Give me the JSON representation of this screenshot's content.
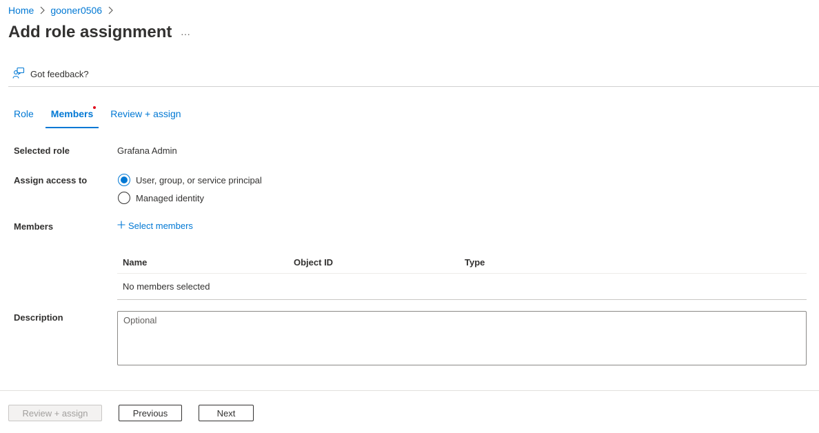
{
  "breadcrumb": {
    "items": [
      "Home",
      "gooner0506"
    ]
  },
  "page": {
    "title": "Add role assignment",
    "more_label": "···"
  },
  "feedback": {
    "label": "Got feedback?"
  },
  "tabs": [
    {
      "label": "Role",
      "active": false
    },
    {
      "label": "Members",
      "active": true
    },
    {
      "label": "Review + assign",
      "active": false
    }
  ],
  "form": {
    "selected_role": {
      "label": "Selected role",
      "value": "Grafana Admin"
    },
    "assign_access": {
      "label": "Assign access to",
      "options": [
        {
          "label": "User, group, or service principal",
          "checked": true
        },
        {
          "label": "Managed identity",
          "checked": false
        }
      ]
    },
    "members": {
      "label": "Members",
      "select_label": "Select members",
      "columns": [
        "Name",
        "Object ID",
        "Type"
      ],
      "empty_text": "No members selected"
    },
    "description": {
      "label": "Description",
      "placeholder": "Optional"
    }
  },
  "footer": {
    "review_assign": "Review + assign",
    "previous": "Previous",
    "next": "Next"
  },
  "colors": {
    "accent": "#0078d4",
    "required_dot": "#e00b1c",
    "text": "#323130"
  },
  "icons": {
    "breadcrumb_separator": "chevron-right-icon",
    "feedback": "feedback-person-icon",
    "select_members": "plus-icon"
  }
}
